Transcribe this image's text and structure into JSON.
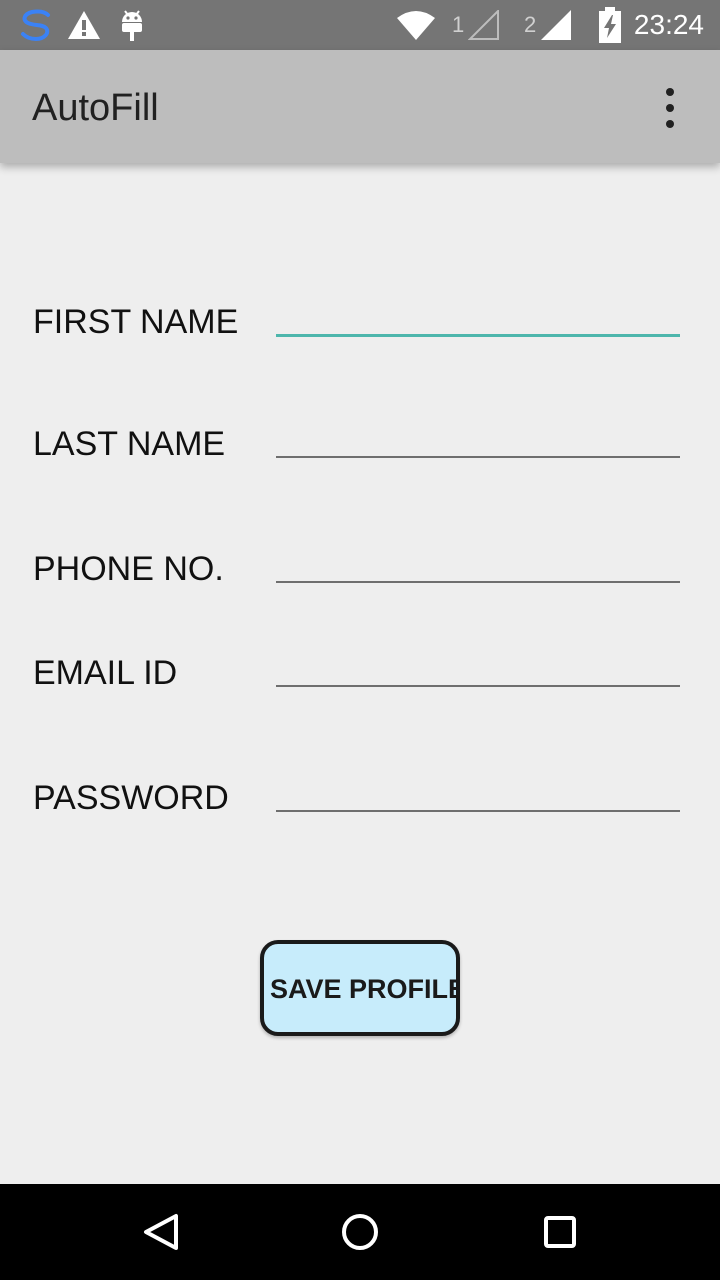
{
  "status_bar": {
    "time": "23:24",
    "sim1_label": "1",
    "sim2_label": "2",
    "icons": [
      "sync-icon",
      "warning-icon",
      "android-debug-icon",
      "wifi-icon",
      "signal-sim1-icon",
      "signal-sim2-icon",
      "battery-charging-icon"
    ]
  },
  "app_bar": {
    "title": "AutoFill",
    "menu_icon": "overflow-menu-icon"
  },
  "form": {
    "fields": [
      {
        "label": "FIRST NAME",
        "value": "",
        "focused": true
      },
      {
        "label": "LAST NAME",
        "value": ""
      },
      {
        "label": "PHONE NO.",
        "value": ""
      },
      {
        "label": "EMAIL ID",
        "value": ""
      },
      {
        "label": "PASSWORD",
        "value": ""
      }
    ],
    "save_label": "SAVE PROFILE"
  },
  "nav_bar": {
    "icons": [
      "back-icon",
      "home-icon",
      "recents-icon"
    ]
  },
  "colors": {
    "status_bar": "#757575",
    "app_bar": "#bdbdbd",
    "background": "#eeeeee",
    "focus_accent": "#4db6ac",
    "button_fill": "#c7ecfb"
  }
}
